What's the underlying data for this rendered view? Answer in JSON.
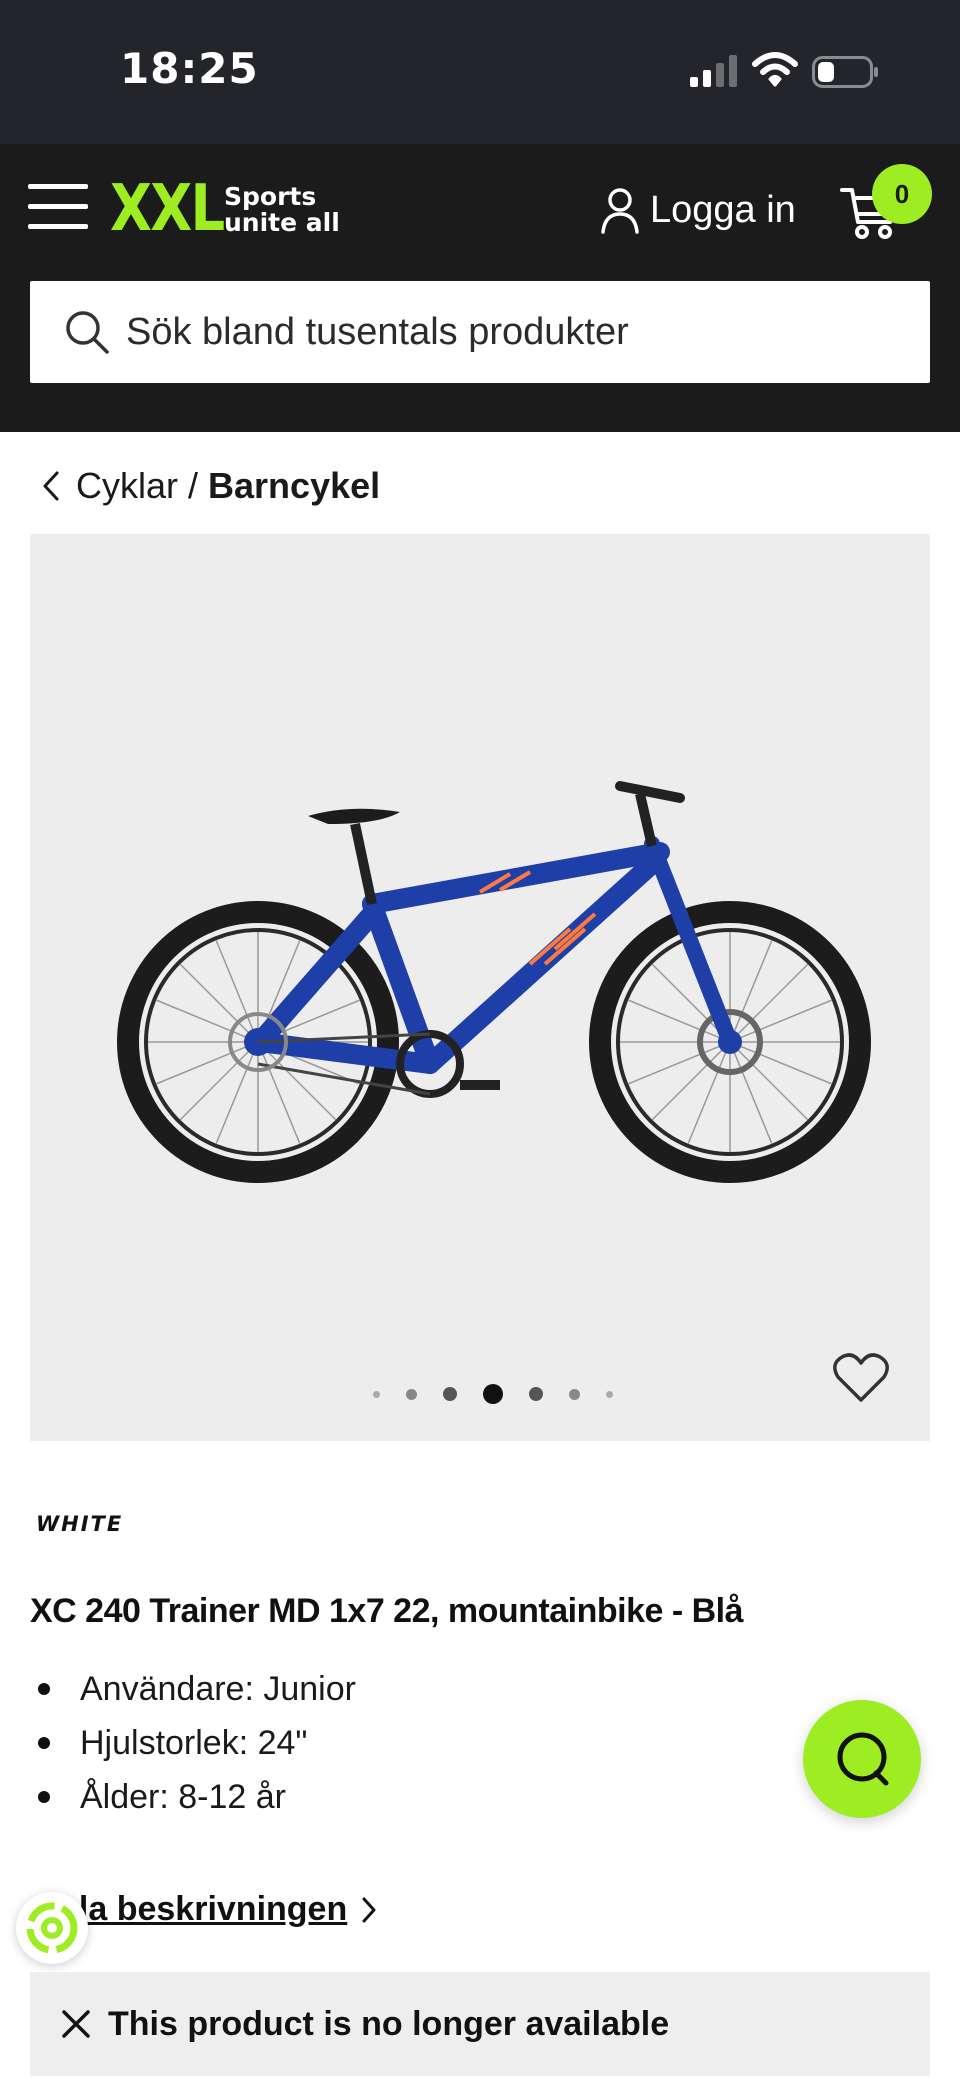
{
  "status_bar": {
    "time": "18:25"
  },
  "header": {
    "logo_text": "XXL",
    "logo_tagline_1": "Sports",
    "logo_tagline_2": "unite all",
    "login_label": "Logga in",
    "cart_count": "0",
    "search_placeholder": "Sök bland tusentals produkter"
  },
  "breadcrumb": {
    "parent": "Cyklar",
    "separator": "/",
    "current": "Barncykel"
  },
  "gallery": {
    "dot_count": 7,
    "active_dot": 4
  },
  "product": {
    "brand": "WHITE",
    "title": "XC 240 Trainer MD 1x7 22, mountainbike - Blå",
    "specs": [
      "Användare: Junior",
      "Hjulstorlek: 24\"",
      "Ålder: 8-12 år"
    ],
    "description_link": "ela beskrivningen",
    "availability_notice": "This product is no longer available"
  },
  "colors": {
    "brand_green": "#9ded22",
    "header_bg": "#1b1b1b",
    "bike_blue": "#1f3fa8",
    "bike_accent": "#ff7a3d"
  }
}
